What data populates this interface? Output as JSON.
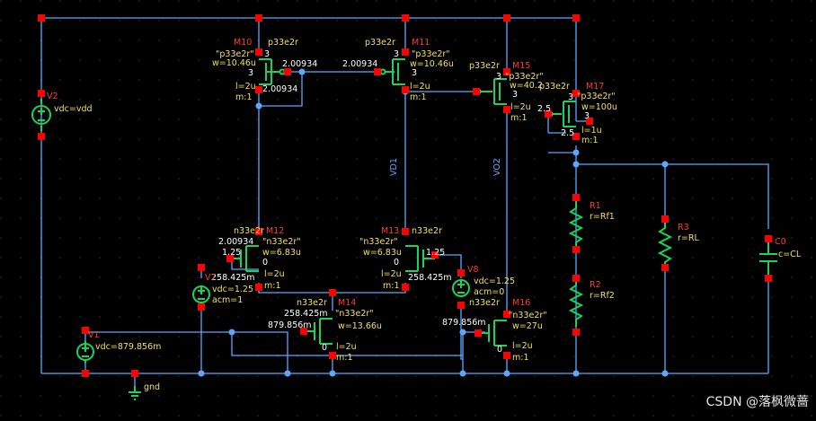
{
  "schematic": {
    "nets": {
      "vd1": "VD1",
      "vo2": "VO2",
      "gnd": "gnd"
    },
    "transistors": {
      "m10": {
        "name": "M10",
        "model": "p33e2r",
        "model_q": "\"p33e2r\"",
        "w": "w=10.46u",
        "l": "l=2u",
        "m": "m:1",
        "pin": "3",
        "v_gate": "2.00934",
        "v_drain": "2.00934"
      },
      "m11": {
        "name": "M11",
        "model": "p33e2r",
        "model_q": "\"p33e2r\"",
        "w": "w=10.46u",
        "l": "l=2u",
        "m": "m:1",
        "pin": "3",
        "v_gate": "2.00934"
      },
      "m15": {
        "name": "M15",
        "model": "p33e2r",
        "model_q": "\"p33e2r\"",
        "w": "w=40.2",
        "l": "l=2u",
        "m": "m:1",
        "pin": "3"
      },
      "m17": {
        "name": "M17",
        "model": "p33e2r",
        "model_q": "\"p33e2r\"",
        "w": "w=100u",
        "l": "l=1u",
        "m": "m:1",
        "pin": "3",
        "v_gate": "2.5",
        "v_drain": "2.5"
      },
      "m12": {
        "name": "M12",
        "model": "n33e2r",
        "model_q": "\"n33e2r\"",
        "w": "w=6.83u",
        "l": "l=2u",
        "m": "m:1",
        "v_drain": "2.00934",
        "v_gate": "1.25",
        "v_source": "258.425m",
        "bulk": "0"
      },
      "m13": {
        "name": "M13",
        "model": "n33e2r",
        "model_q": "\"n33e2r\"",
        "w": "w=6.83u",
        "l": "l=2u",
        "m": "m:1",
        "v_gate": "1.25",
        "v_source": "258.425m",
        "bulk": "0"
      },
      "m14": {
        "name": "M14",
        "model": "n33e2r",
        "model_q": "\"n33e2r\"",
        "w": "w=13.66u",
        "l": "l=2u",
        "m": "m:1",
        "v_drain": "258.425m",
        "v_gate": "879.856m",
        "bulk": "0"
      },
      "m16": {
        "name": "M16",
        "model": "n33e2r",
        "model_q": "\"n33e2r\"",
        "w": "w=27u",
        "l": "l=2u",
        "m": "m:1",
        "v_gate": "879.856m",
        "bulk": "0"
      }
    },
    "sources": {
      "v2": {
        "name": "V2",
        "value": "vdc=vdd"
      },
      "v1": {
        "name": "V1",
        "value": "vdc=879.856m"
      },
      "v7": {
        "name": "V7",
        "value": "vdc=1.25",
        "acm": "acm=1"
      },
      "v8": {
        "name": "V8",
        "value": "vdc=1.25",
        "acm": "acm=0"
      }
    },
    "passives": {
      "r1": {
        "name": "R1",
        "value": "r=Rf1"
      },
      "r2": {
        "name": "R2",
        "value": "r=Rf2"
      },
      "r3": {
        "name": "R3",
        "value": "r=RL"
      },
      "c0": {
        "name": "C0",
        "value": "c=CL"
      }
    }
  },
  "watermark": "CSDN @落枫微蔷",
  "colors": {
    "background": "#000000",
    "wire": "#5aa9ff",
    "device": "#19d35a",
    "pin": "#ff0000",
    "instance_label": "#ff3b2f",
    "param_label": "#f0e060",
    "node_voltage": "#ffffff",
    "grid_dot": "#1d2d6b"
  }
}
